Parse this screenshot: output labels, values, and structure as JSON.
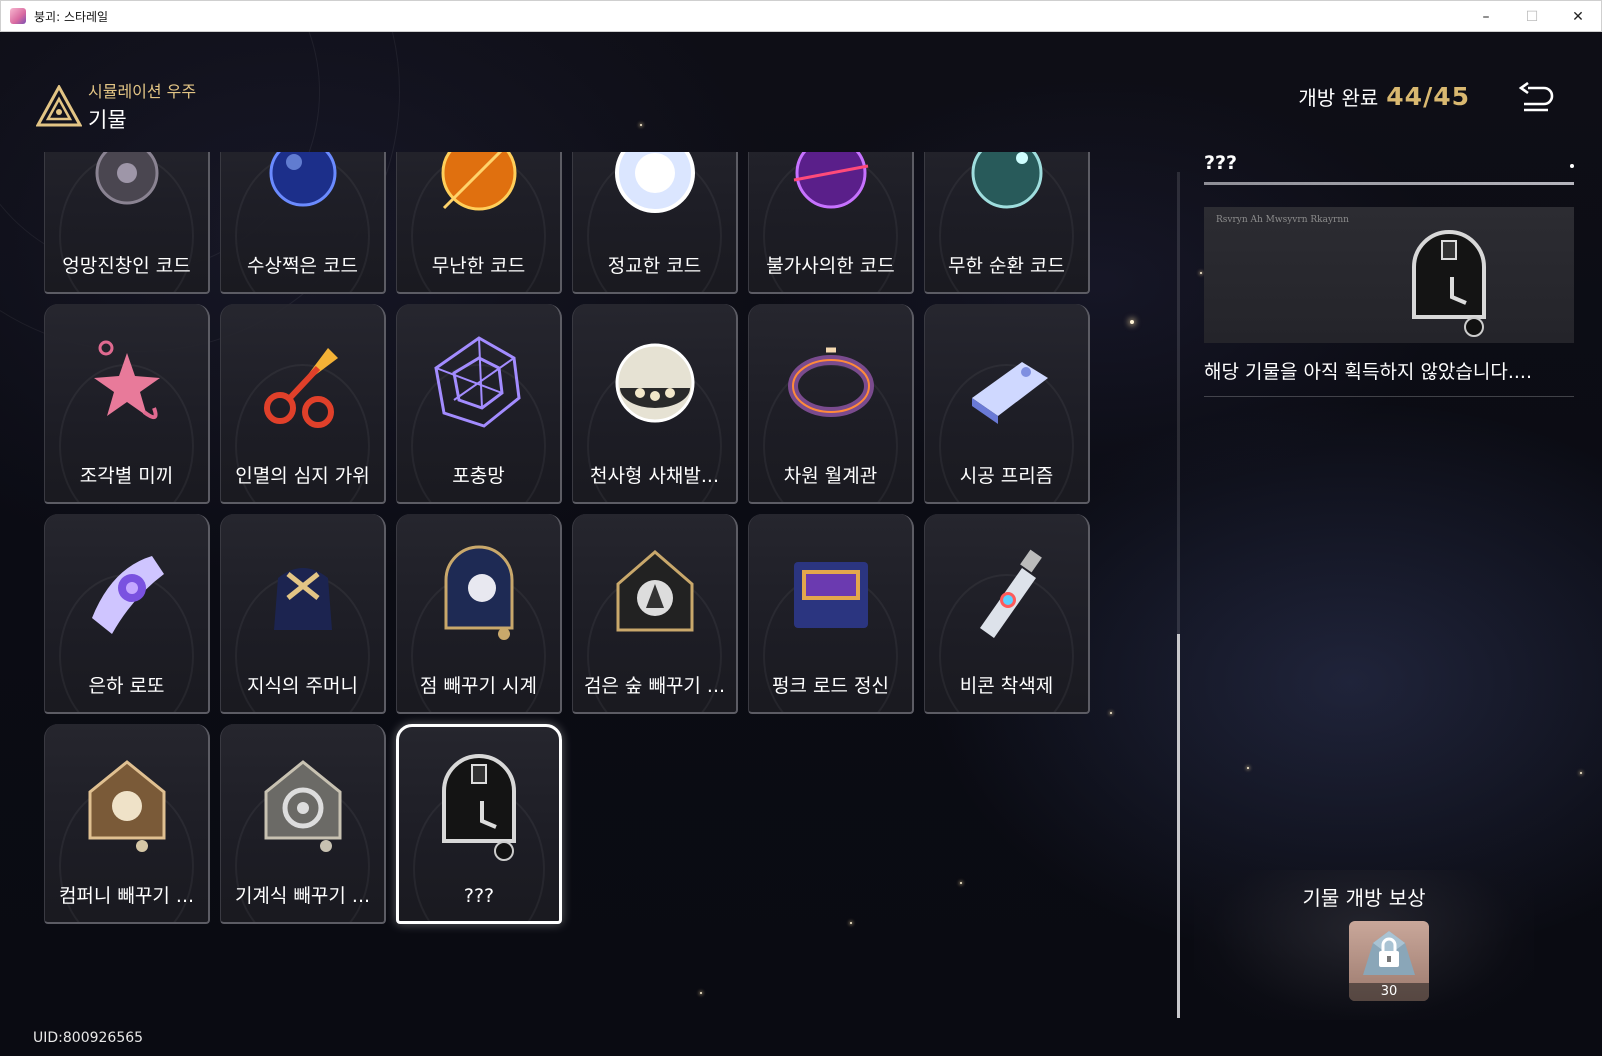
{
  "window": {
    "title": "붕괴: 스타레일",
    "minimize": "–",
    "maximize": "☐",
    "close": "✕"
  },
  "header": {
    "section": "시뮬레이션 우주",
    "title": "기물"
  },
  "progress": {
    "label": "개방 완료",
    "value": "44/45"
  },
  "curios": [
    {
      "name": "엉망진창인 코드",
      "icon": "grey-orb-icon"
    },
    {
      "name": "수상쩍은 코드",
      "icon": "blue-orb-icon"
    },
    {
      "name": "무난한 코드",
      "icon": "orange-orb-icon"
    },
    {
      "name": "정교한 코드",
      "icon": "white-orb-icon"
    },
    {
      "name": "불가사의한 코드",
      "icon": "purple-orb-icon"
    },
    {
      "name": "무한 순환 코드",
      "icon": "teal-orb-icon"
    },
    {
      "name": "조각별 미끼",
      "icon": "star-lure-icon"
    },
    {
      "name": "인멸의 심지 가위",
      "icon": "scissors-icon"
    },
    {
      "name": "포충망",
      "icon": "spiderweb-icon"
    },
    {
      "name": "천사형 사채발...",
      "icon": "angel-orb-icon"
    },
    {
      "name": "차원 월계관",
      "icon": "laurel-crown-icon"
    },
    {
      "name": "시공 프리즘",
      "icon": "prism-icon"
    },
    {
      "name": "은하 로또",
      "icon": "lottery-ticket-icon"
    },
    {
      "name": "지식의 주머니",
      "icon": "pouch-icon"
    },
    {
      "name": "점 빼꾸기 시계",
      "icon": "pearl-clock-icon"
    },
    {
      "name": "검은 숲 빼꾸기 ...",
      "icon": "blackforest-clock-icon"
    },
    {
      "name": "펑크 로드 정신",
      "icon": "cassette-icon"
    },
    {
      "name": "비콘 착색제",
      "icon": "paint-tube-icon"
    },
    {
      "name": "컴퍼니 빼꾸기 ...",
      "icon": "company-clock-icon"
    },
    {
      "name": "기계식 빼꾸기 ...",
      "icon": "mechanical-clock-icon"
    },
    {
      "name": "???",
      "icon": "unknown-clock-icon"
    }
  ],
  "selected_index": 20,
  "detail": {
    "title": "???",
    "banner_text": "Rsvryn Ah Mwsyvrn Rkayrnn",
    "description": "해당 기물을 아직 획득하지 않았습니다...."
  },
  "reward": {
    "title": "기물 개방 보상",
    "count": "30"
  },
  "uid": "UID:800926565",
  "colors": {
    "accent_gold": "#d9b870",
    "section_gold": "#e3c585"
  }
}
